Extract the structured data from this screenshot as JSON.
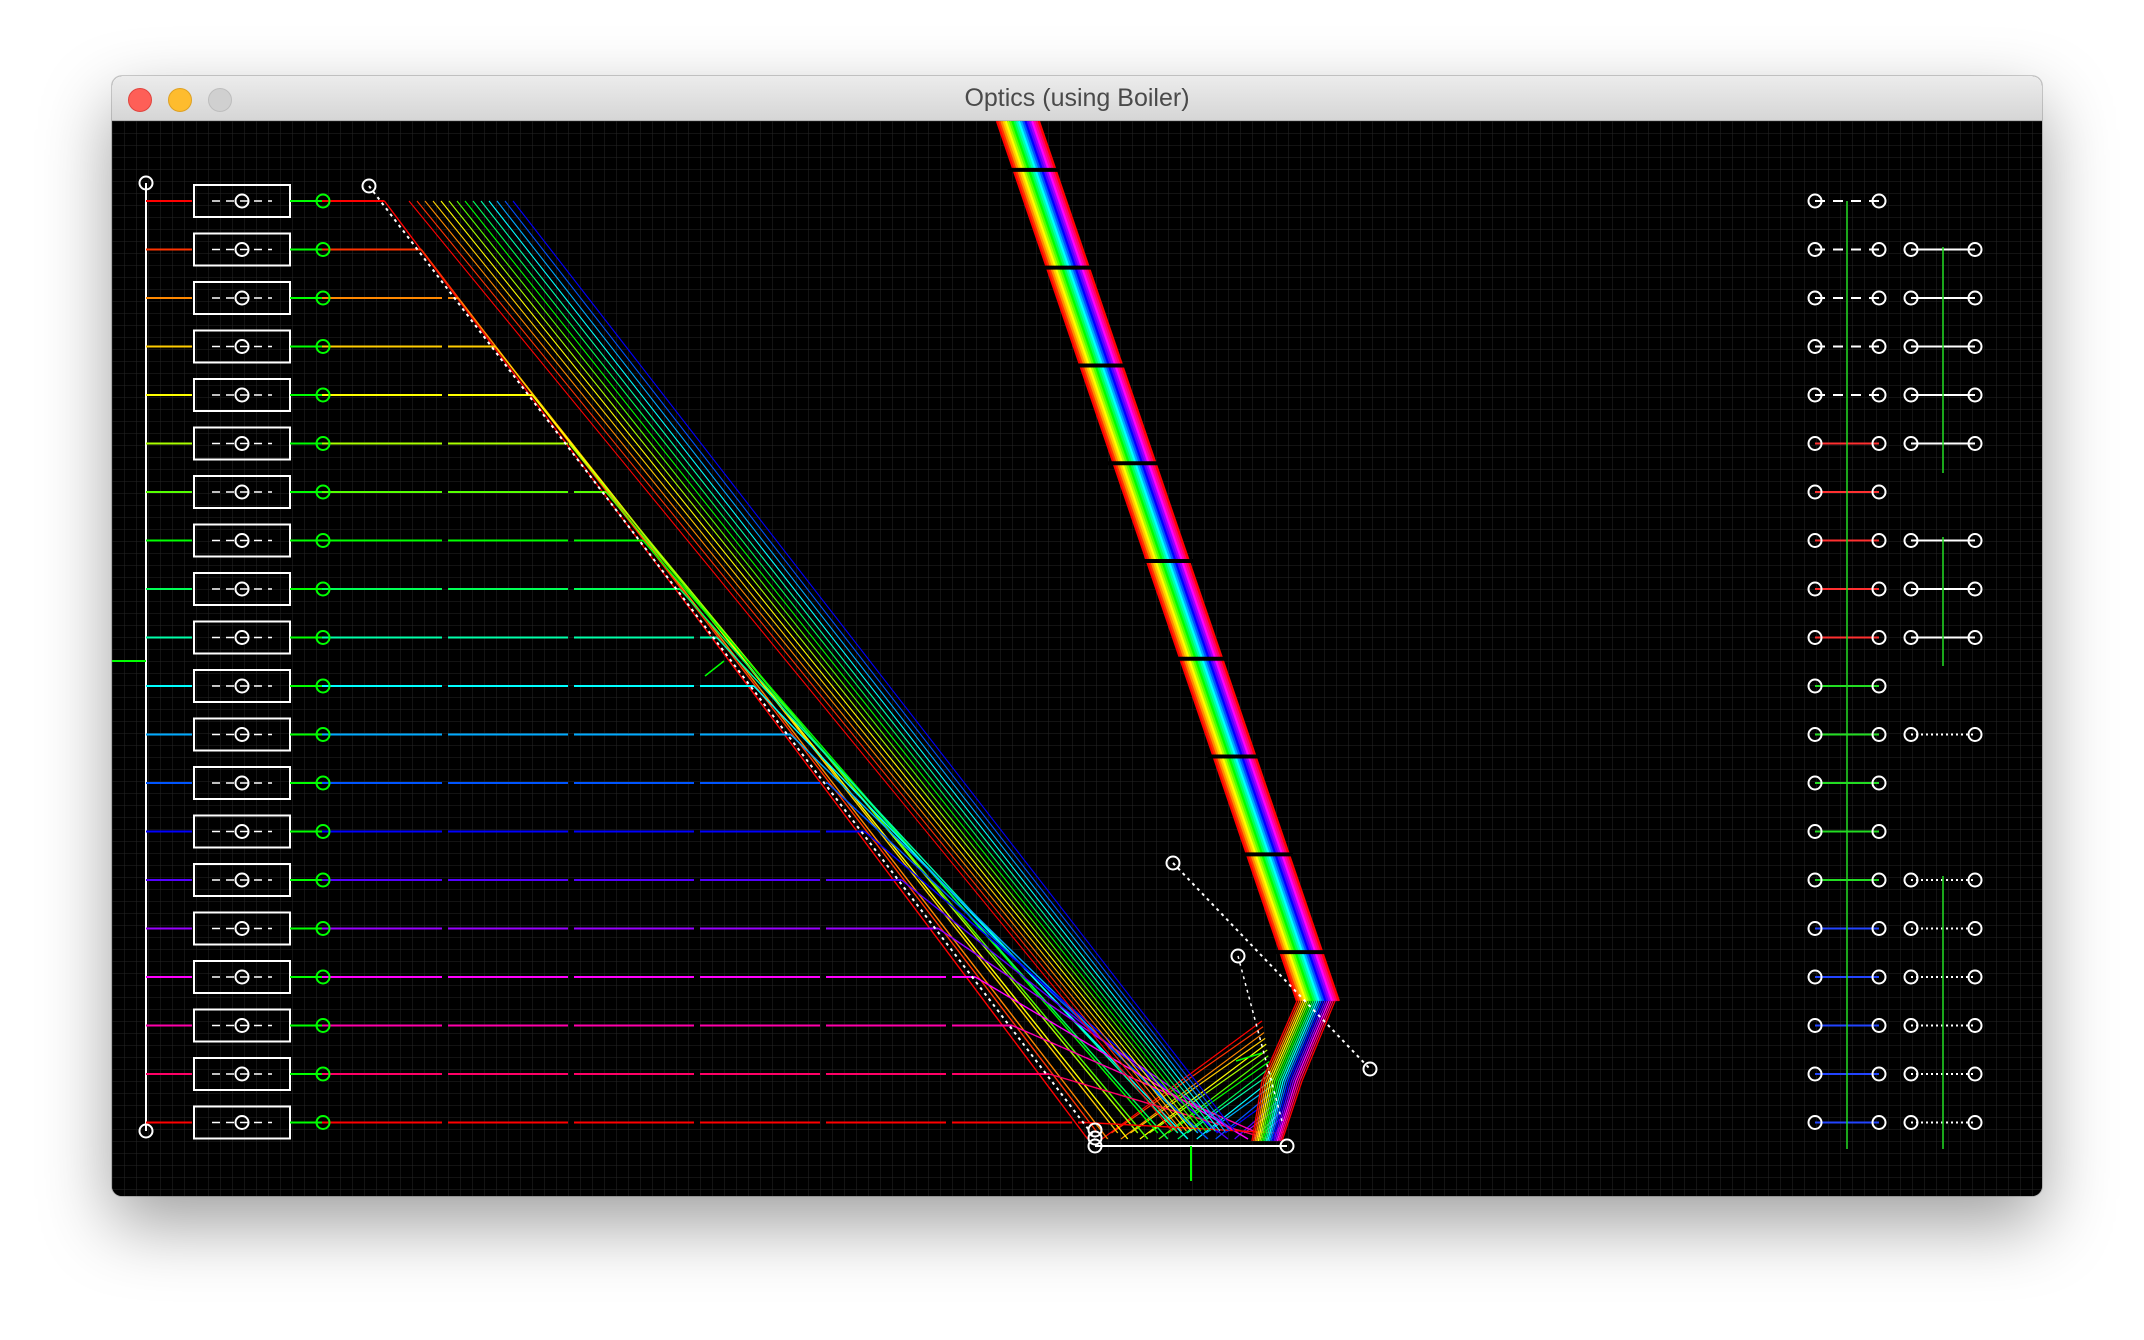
{
  "window": {
    "title": "Optics (using Boiler)"
  },
  "colors": {
    "canvas_bg": "#000000",
    "grid": "#2a2a2a",
    "handle": "#ffffff",
    "source_marker": "#00ff00"
  },
  "spectrum": [
    "#ff0000",
    "#ff3300",
    "#ff8800",
    "#ffcc00",
    "#ffff00",
    "#aaff00",
    "#55ff00",
    "#00ff00",
    "#00ff55",
    "#00ffaa",
    "#00ffff",
    "#00aaff",
    "#0055ff",
    "#0000ff",
    "#5500ff",
    "#9900ff",
    "#ff00ff",
    "#ff00aa",
    "#ff0066",
    "#ff0000"
  ],
  "right_panel_rows": [
    {
      "left": "dashed",
      "right": "none"
    },
    {
      "left": "dashed",
      "right": "solid"
    },
    {
      "left": "dashed",
      "right": "solid"
    },
    {
      "left": "dashed",
      "right": "solid"
    },
    {
      "left": "dashed",
      "right": "solid"
    },
    {
      "left": "red",
      "right": "solid"
    },
    {
      "left": "red",
      "right": "none"
    },
    {
      "left": "red",
      "right": "solid"
    },
    {
      "left": "red",
      "right": "solid"
    },
    {
      "left": "red",
      "right": "solid"
    },
    {
      "left": "green",
      "right": "none"
    },
    {
      "left": "green",
      "right": "dotted"
    },
    {
      "left": "green",
      "right": "none"
    },
    {
      "left": "green",
      "right": "none"
    },
    {
      "left": "green",
      "right": "dotted"
    },
    {
      "left": "blue",
      "right": "dotted"
    },
    {
      "left": "blue",
      "right": "dotted"
    },
    {
      "left": "blue",
      "right": "dotted"
    },
    {
      "left": "blue",
      "right": "dotted"
    },
    {
      "left": "blue",
      "right": "dotted"
    }
  ]
}
